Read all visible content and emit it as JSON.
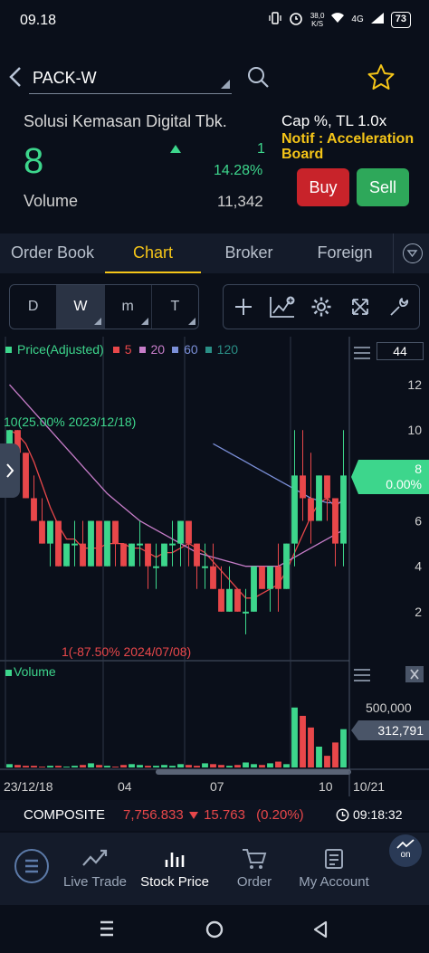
{
  "status_bar": {
    "time": "09.18",
    "net_speed": "38,0",
    "net_unit": "K/S",
    "network": "4G",
    "battery": "73"
  },
  "header": {
    "symbol": "PACK-W",
    "company": "Solusi Kemasan Digital Tbk.",
    "price": "8",
    "change": "1",
    "change_pct": "14.28%",
    "volume_label": "Volume",
    "volume_value": "11,342",
    "cap_info": "Cap %, TL 1.0x",
    "notif": "Notif : Acceleration Board",
    "buy_label": "Buy",
    "sell_label": "Sell",
    "up_color": "#3dd68c",
    "down_color": "#e8474a"
  },
  "tabs": [
    {
      "label": "Order Book",
      "active": false
    },
    {
      "label": "Chart",
      "active": true
    },
    {
      "label": "Broker",
      "active": false
    },
    {
      "label": "Foreign",
      "active": false
    }
  ],
  "periods": [
    {
      "label": "D",
      "active": false
    },
    {
      "label": "W",
      "active": true
    },
    {
      "label": "m",
      "active": false
    },
    {
      "label": "T",
      "active": false
    }
  ],
  "chart_labels": {
    "price_legend": "Price(Adjusted)",
    "ma": [
      {
        "label": "5",
        "color": "#e8474a"
      },
      {
        "label": "20",
        "color": "#c77dc9"
      },
      {
        "label": "60",
        "color": "#7b8fd8"
      },
      {
        "label": "120",
        "color": "#2a8f86"
      }
    ],
    "fib_top": "10(25.00% 2023/12/18)",
    "fib_bottom": "1(-87.50% 2024/07/08)",
    "volume_legend": "Volume",
    "last_box": "44",
    "price_tag_value": "8",
    "price_tag_pct": "0.00%",
    "volume_tick": "500,000",
    "volume_tag": "312,791"
  },
  "chart_data": {
    "type": "candlestick",
    "y_ticks": [
      12,
      10,
      8,
      6,
      4,
      2
    ],
    "ylim": [
      0,
      13
    ],
    "x_ticks": [
      "23/12/18",
      "04",
      "07",
      "10",
      "10/21"
    ],
    "candles": [
      {
        "o": 9,
        "h": 10,
        "l": 8,
        "c": 10
      },
      {
        "o": 10,
        "h": 10,
        "l": 8,
        "c": 9
      },
      {
        "o": 9,
        "h": 9,
        "l": 7,
        "c": 7
      },
      {
        "o": 7,
        "h": 8,
        "l": 6,
        "c": 6
      },
      {
        "o": 6,
        "h": 7,
        "l": 5,
        "c": 5
      },
      {
        "o": 5,
        "h": 6,
        "l": 4,
        "c": 6
      },
      {
        "o": 6,
        "h": 6,
        "l": 4,
        "c": 4
      },
      {
        "o": 4,
        "h": 5,
        "l": 4,
        "c": 5
      },
      {
        "o": 5,
        "h": 6,
        "l": 4,
        "c": 5
      },
      {
        "o": 5,
        "h": 6,
        "l": 4,
        "c": 4
      },
      {
        "o": 4,
        "h": 6,
        "l": 4,
        "c": 6
      },
      {
        "o": 6,
        "h": 6,
        "l": 4,
        "c": 4
      },
      {
        "o": 4,
        "h": 6,
        "l": 4,
        "c": 6
      },
      {
        "o": 6,
        "h": 6,
        "l": 4,
        "c": 5
      },
      {
        "o": 5,
        "h": 5,
        "l": 4,
        "c": 4
      },
      {
        "o": 4,
        "h": 5,
        "l": 4,
        "c": 5
      },
      {
        "o": 5,
        "h": 6,
        "l": 4,
        "c": 5
      },
      {
        "o": 5,
        "h": 5,
        "l": 3,
        "c": 4
      },
      {
        "o": 4,
        "h": 5,
        "l": 3,
        "c": 4
      },
      {
        "o": 4,
        "h": 5,
        "l": 4,
        "c": 5
      },
      {
        "o": 5,
        "h": 6,
        "l": 4,
        "c": 5
      },
      {
        "o": 5,
        "h": 6,
        "l": 4,
        "c": 6
      },
      {
        "o": 6,
        "h": 6,
        "l": 4,
        "c": 5
      },
      {
        "o": 5,
        "h": 5,
        "l": 3,
        "c": 4
      },
      {
        "o": 4,
        "h": 5,
        "l": 3,
        "c": 4
      },
      {
        "o": 4,
        "h": 5,
        "l": 3,
        "c": 3
      },
      {
        "o": 3,
        "h": 4,
        "l": 2,
        "c": 2
      },
      {
        "o": 2,
        "h": 4,
        "l": 2,
        "c": 3
      },
      {
        "o": 3,
        "h": 3,
        "l": 2,
        "c": 2
      },
      {
        "o": 2,
        "h": 3,
        "l": 1,
        "c": 2
      },
      {
        "o": 2,
        "h": 4,
        "l": 2,
        "c": 4
      },
      {
        "o": 4,
        "h": 4,
        "l": 3,
        "c": 3
      },
      {
        "o": 3,
        "h": 4,
        "l": 2,
        "c": 4
      },
      {
        "o": 4,
        "h": 5,
        "l": 2,
        "c": 3
      },
      {
        "o": 3,
        "h": 5,
        "l": 3,
        "c": 5
      },
      {
        "o": 5,
        "h": 10,
        "l": 4,
        "c": 8
      },
      {
        "o": 8,
        "h": 10,
        "l": 6,
        "c": 7
      },
      {
        "o": 7,
        "h": 9,
        "l": 5,
        "c": 6
      },
      {
        "o": 6,
        "h": 8,
        "l": 6,
        "c": 8
      },
      {
        "o": 8,
        "h": 8,
        "l": 6,
        "c": 7
      },
      {
        "o": 7,
        "h": 7,
        "l": 4,
        "c": 5
      },
      {
        "o": 5,
        "h": 10,
        "l": 4,
        "c": 8
      }
    ],
    "volumes": [
      0.04,
      0.03,
      0.02,
      0.02,
      0.01,
      0.02,
      0.02,
      0.01,
      0.02,
      0.03,
      0.05,
      0.03,
      0.02,
      0.01,
      0.03,
      0.04,
      0.03,
      0.02,
      0.02,
      0.03,
      0.02,
      0.04,
      0.03,
      0.02,
      0.05,
      0.04,
      0.03,
      0.02,
      0.03,
      0.06,
      0.04,
      0.03,
      0.05,
      0.07,
      0.04,
      0.72,
      0.62,
      0.48,
      0.25,
      0.14,
      0.3,
      0.46
    ],
    "series": [
      {
        "name": "5",
        "values": [
          10,
          9.8,
          9.4,
          8.6,
          7.6,
          6.6,
          5.8,
          5.2,
          5.2,
          4.8,
          4.8,
          4.8,
          5,
          5,
          5,
          4.8,
          4.8,
          4.6,
          4.4,
          4.6,
          4.6,
          4.8,
          5,
          4.8,
          4.6,
          4.2,
          3.8,
          3.4,
          3.0,
          2.6,
          2.6,
          2.8,
          3.0,
          3.2,
          3.8,
          4.6,
          5.4,
          6.2,
          6.8,
          7.0,
          6.6,
          7.0
        ]
      },
      {
        "name": "20",
        "values": [
          12,
          11.6,
          11.2,
          10.8,
          10.4,
          10,
          9.6,
          9.2,
          8.8,
          8.4,
          8,
          7.6,
          7.2,
          6.9,
          6.6,
          6.3,
          6.0,
          5.8,
          5.6,
          5.4,
          5.2,
          5.0,
          4.8,
          4.6,
          4.5,
          4.4,
          4.3,
          4.2,
          4.1,
          4.0,
          4.0,
          4.0,
          4.0,
          4.0,
          4.2,
          4.4,
          4.6,
          4.8,
          5.0,
          5.2,
          5.4,
          5.6
        ]
      },
      {
        "name": "60",
        "values": [
          null,
          null,
          null,
          null,
          null,
          null,
          null,
          null,
          null,
          null,
          null,
          null,
          null,
          null,
          null,
          null,
          null,
          null,
          null,
          null,
          null,
          null,
          null,
          null,
          null,
          9.4,
          9.2,
          9.0,
          8.8,
          8.6,
          8.4,
          8.2,
          8.0,
          7.8,
          7.6,
          7.4,
          7.2,
          7.0,
          6.9,
          6.8,
          6.8,
          6.8
        ]
      }
    ]
  },
  "composite": {
    "name": "COMPOSITE",
    "value": "7,756.833",
    "change": "15.763",
    "pct": "(0.20%)",
    "time": "09:18:32"
  },
  "nav": {
    "items": [
      {
        "label": "Live Trade",
        "icon": "chart-up-icon",
        "active": false
      },
      {
        "label": "Stock Price",
        "icon": "bar-chart-icon",
        "active": true
      },
      {
        "label": "Order",
        "icon": "cart-icon",
        "active": false
      },
      {
        "label": "My Account",
        "icon": "account-icon",
        "active": false
      }
    ],
    "on_label": "on"
  }
}
